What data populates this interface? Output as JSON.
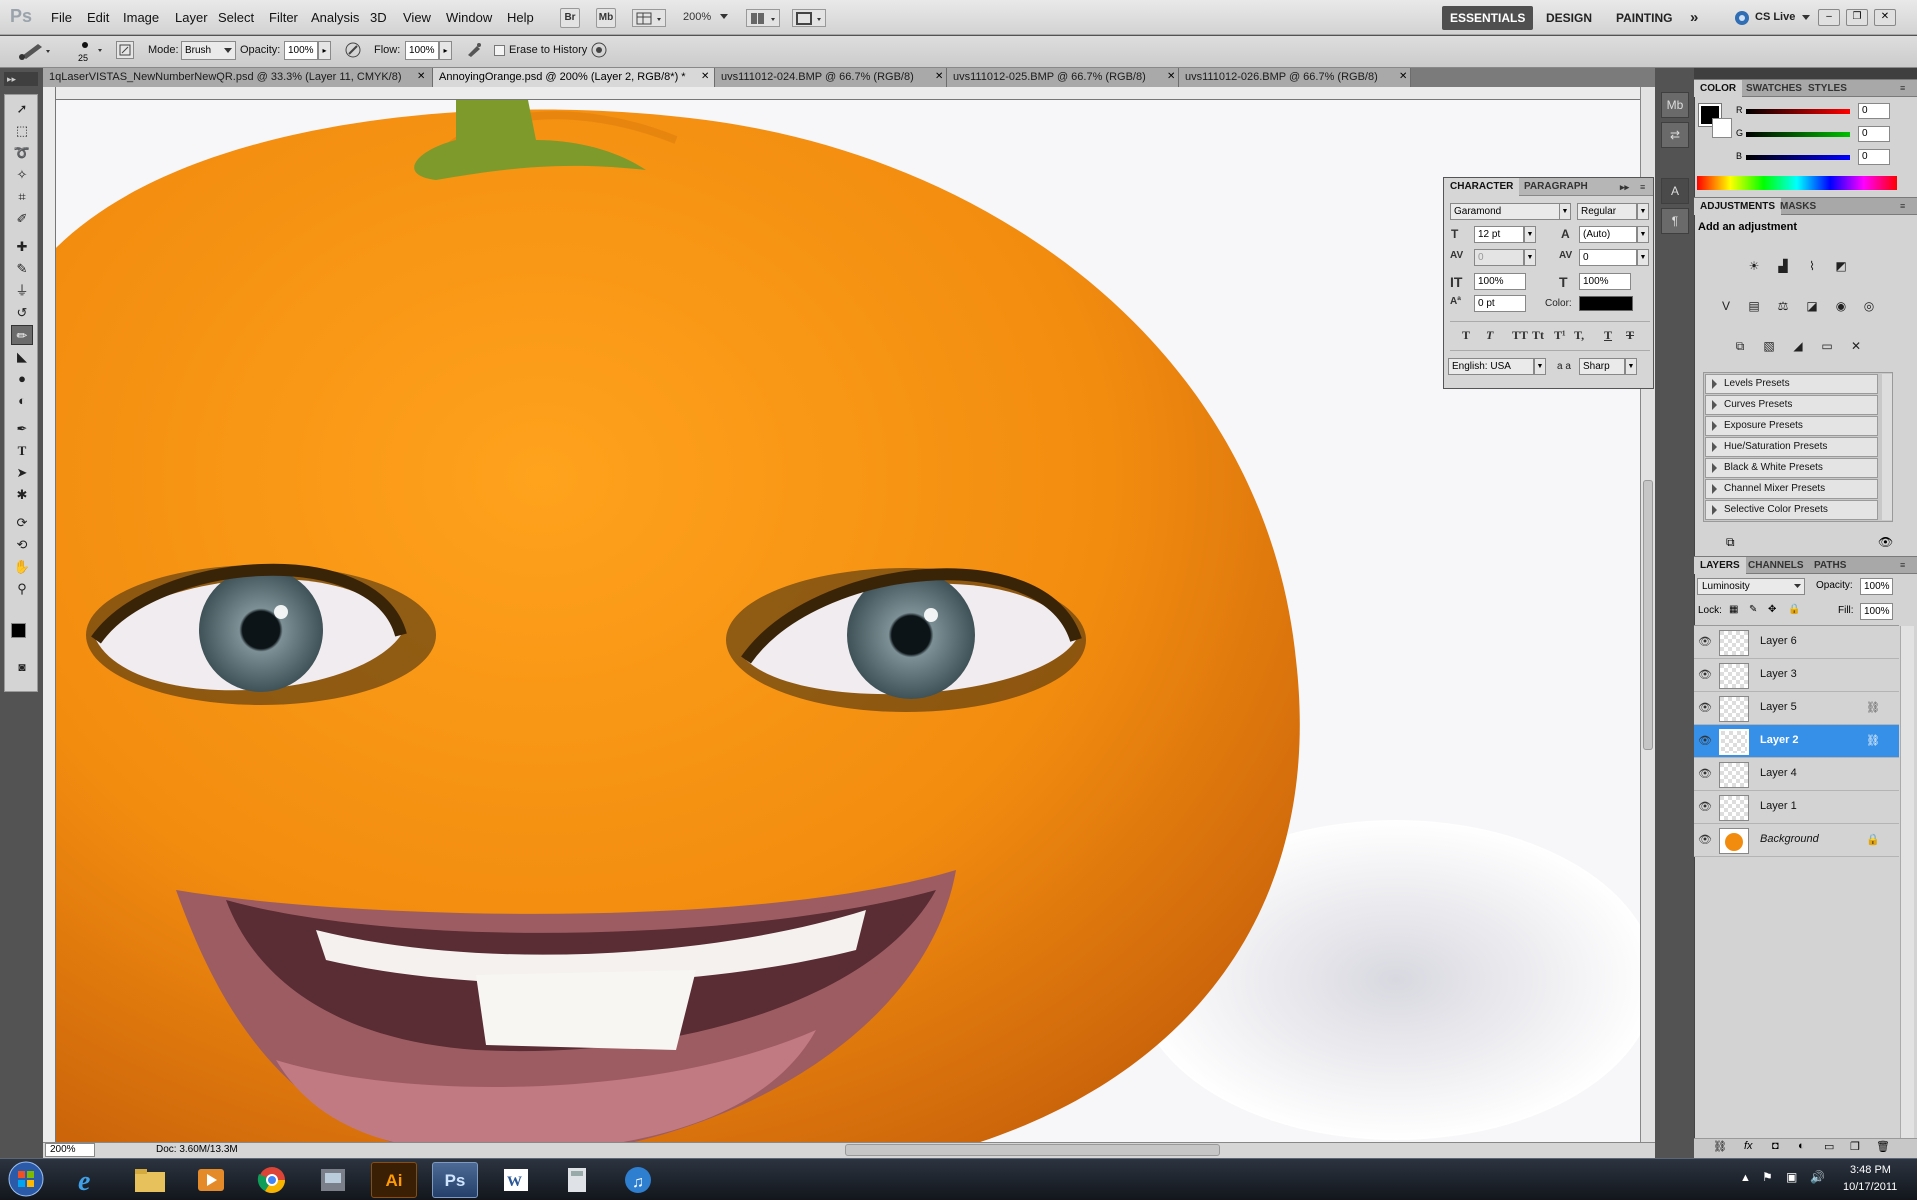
{
  "app": {
    "logo": "Ps"
  },
  "menu": [
    "File",
    "Edit",
    "Image",
    "Layer",
    "Select",
    "Filter",
    "Analysis",
    "3D",
    "View",
    "Window",
    "Help"
  ],
  "bridge": {
    "br": "Br",
    "mb": "Mb",
    "zoom": "200%"
  },
  "workspaces": {
    "essentials": "ESSENTIALS",
    "design": "DESIGN",
    "painting": "PAINTING",
    "more": "»",
    "cslive": "CS Live"
  },
  "options": {
    "brush_size": "25",
    "mode_label": "Mode:",
    "mode_value": "Brush",
    "opacity_label": "Opacity:",
    "opacity_value": "100%",
    "flow_label": "Flow:",
    "flow_value": "100%",
    "erase_history": "Erase to History"
  },
  "tabs": [
    {
      "label": "1qLaserVISTAS_NewNumberNewQR.psd @ 33.3% (Layer 11, CMYK/8)"
    },
    {
      "label": "AnnoyingOrange.psd @ 200% (Layer 2, RGB/8*) *"
    },
    {
      "label": "uvs111012-024.BMP @ 66.7% (RGB/8)"
    },
    {
      "label": "uvs111012-025.BMP @ 66.7% (RGB/8)"
    },
    {
      "label": "uvs111012-026.BMP @ 66.7% (RGB/8)"
    }
  ],
  "status": {
    "zoom": "200%",
    "doc": "Doc: 3.60M/13.3M"
  },
  "character": {
    "tabs": [
      "CHARACTER",
      "PARAGRAPH"
    ],
    "font": "Garamond",
    "style": "Regular",
    "size": "12 pt",
    "leading": "(Auto)",
    "kerning": "0",
    "tracking": "0",
    "vscale": "100%",
    "hscale": "100%",
    "baseline": "0 pt",
    "color_label": "Color:",
    "language": "English: USA",
    "aa_label": "a a",
    "antialias": "Sharp",
    "glyphs": [
      "T",
      "T",
      "TT",
      "Tt",
      "T¹",
      "T,",
      "T",
      "T"
    ]
  },
  "color_panel": {
    "tabs": [
      "COLOR",
      "SWATCHES",
      "STYLES"
    ],
    "r_label": "R",
    "g_label": "G",
    "b_label": "B",
    "r": "0",
    "g": "0",
    "b": "0"
  },
  "adjustments": {
    "tabs": [
      "ADJUSTMENTS",
      "MASKS"
    ],
    "heading": "Add an adjustment",
    "presets": [
      "Levels Presets",
      "Curves Presets",
      "Exposure Presets",
      "Hue/Saturation Presets",
      "Black & White Presets",
      "Channel Mixer Presets",
      "Selective Color Presets"
    ]
  },
  "layers_panel": {
    "tabs": [
      "LAYERS",
      "CHANNELS",
      "PATHS"
    ],
    "blend_mode": "Luminosity",
    "opacity_label": "Opacity:",
    "opacity": "100%",
    "lock_label": "Lock:",
    "fill_label": "Fill:",
    "fill": "100%",
    "layers": [
      {
        "name": "Layer 6"
      },
      {
        "name": "Layer 3"
      },
      {
        "name": "Layer 5"
      },
      {
        "name": "Layer 2"
      },
      {
        "name": "Layer 4"
      },
      {
        "name": "Layer 1"
      },
      {
        "name": "Background"
      }
    ]
  },
  "taskbar": {
    "time": "3:48 PM",
    "date": "10/17/2011",
    "ai": "Ai",
    "ps": "Ps"
  },
  "colors": {
    "accent": "#3690e8",
    "orange": "#f28c0f",
    "chrome": "#d4d4d4"
  }
}
